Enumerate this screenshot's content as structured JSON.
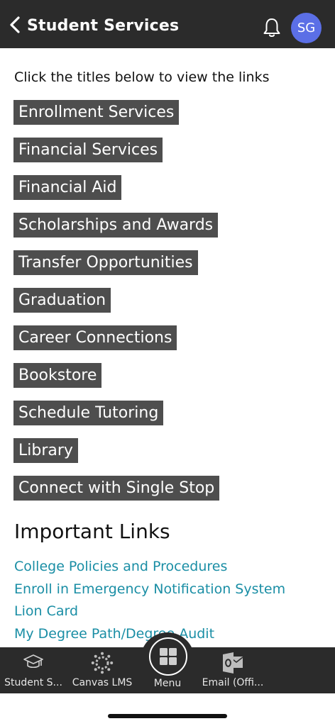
{
  "header": {
    "title": "Student Services",
    "avatar_initials": "SG"
  },
  "intro_text": "Click the titles below to view the links",
  "sections": [
    "Enrollment Services",
    "Financial Services",
    "Financial Aid",
    "Scholarships and Awards",
    "Transfer Opportunities",
    "Graduation",
    "Career Connections",
    "Bookstore",
    "Schedule Tutoring",
    "Library",
    "Connect with Single Stop"
  ],
  "important_links": {
    "heading": "Important Links",
    "items": [
      "College Policies and Procedures",
      "Enroll in Emergency Notification System",
      "Lion Card",
      "My Degree Path/Degree Audit"
    ]
  },
  "tabbar": {
    "tabs": [
      {
        "label": "Student S...",
        "icon": "graduation-cap-icon"
      },
      {
        "label": "Canvas LMS",
        "icon": "canvas-icon"
      },
      {
        "label": "Menu",
        "icon": "grid-icon"
      },
      {
        "label": "Email (Offi...",
        "icon": "outlook-icon"
      }
    ]
  },
  "colors": {
    "header_bg": "#2b2b2b",
    "section_bg": "#4e4e4e",
    "link": "#1a8ea5",
    "avatar": "#5b6fe6"
  }
}
